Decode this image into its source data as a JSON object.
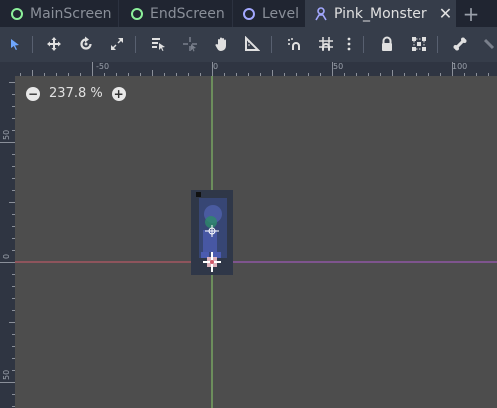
{
  "tabs": [
    {
      "label": "MainScreen",
      "icon": "node-ring-icon",
      "color": "#8cf09a"
    },
    {
      "label": "EndScreen",
      "icon": "node-ring-icon",
      "color": "#8cf09a"
    },
    {
      "label": "Level",
      "icon": "node-ring-icon",
      "color": "#a3a8ff"
    },
    {
      "label": "Pink_Monster",
      "icon": "kinematic-body-icon",
      "color": "#a3a8ff",
      "active": true
    }
  ],
  "tab_close": "✕",
  "new_tab": "+",
  "toolbar": {
    "tools": [
      "select-tool-icon",
      "move-tool-icon",
      "rotate-tool-icon",
      "scale-tool-icon",
      "list-select-icon",
      "pivot-icon",
      "pan-icon",
      "ruler-icon",
      "smart-snap-icon",
      "grid-snap-icon",
      "more-icon",
      "lock-icon",
      "group-icon",
      "bone-icon"
    ]
  },
  "ruler": {
    "top_labels": [
      "-50",
      "0",
      "50",
      "100"
    ],
    "left_labels": [
      "50",
      "0",
      "50"
    ]
  },
  "zoom": {
    "minus": "−",
    "value": "237.8 %",
    "plus": "+"
  },
  "colors": {
    "y_axis": "#8cd06a",
    "x_axis": "#d05a6a",
    "viewport_bg": "#4d4d4d",
    "ruler_bg": "#2f3542",
    "tabbar_bg": "#202531",
    "toolbar_bg": "#363d4a"
  }
}
